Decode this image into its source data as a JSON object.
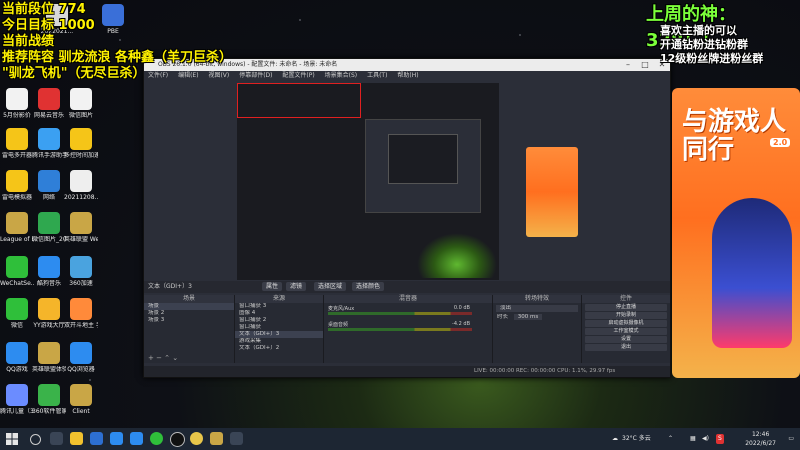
{
  "overlay": {
    "rank": "当前段位 774",
    "goal": "今日目标 1000",
    "record": "当前战绩",
    "lineup": "推荐阵容 驯龙流浪 各种鑫（羊刀巨杀）",
    "lineup2": "\"驯龙飞机\"（无尽巨杀）",
    "god": "上周的神：338！！",
    "notes": [
      "喜欢主播的可以",
      "开通钻粉进钻粉群",
      "12级粉丝牌进粉丝群"
    ]
  },
  "ad": {
    "title": "与游戏人同行",
    "badge": "2.0"
  },
  "desktop_icons": [
    {
      "label": "PBE",
      "color": "#3a6fd8"
    },
    {
      "label": "2022021...",
      "color": "#d8d8d8"
    },
    {
      "label": "5月份影价",
      "color": "#f2f2f2"
    },
    {
      "label": "网易云音乐",
      "color": "#e03232"
    },
    {
      "label": "微信图片",
      "color": "#f2f2f2"
    },
    {
      "label": "雷电多开器",
      "color": "#f5c518"
    },
    {
      "label": "腾讯手游助手",
      "color": "#3ba0f2"
    },
    {
      "label": "多控时间加速",
      "color": "#f5c518"
    },
    {
      "label": "雷电模拟器",
      "color": "#f5c518"
    },
    {
      "label": "网络",
      "color": "#2f7fd8"
    },
    {
      "label": "20211208...",
      "color": "#eeeeee"
    },
    {
      "label": "League of Legends",
      "color": "#c9a646"
    },
    {
      "label": "微信图片_2022021...",
      "color": "#2fa84f"
    },
    {
      "label": "英雄联盟 WeGame版",
      "color": "#c9a646"
    },
    {
      "label": "WeChatSe...",
      "color": "#2fbf3a"
    },
    {
      "label": "酷狗音乐",
      "color": "#2d8cf0"
    },
    {
      "label": "360加速",
      "color": "#4aa3df"
    },
    {
      "label": "微信",
      "color": "#2fbf3a"
    },
    {
      "label": "YY游戏大厅",
      "color": "#f5b52a"
    },
    {
      "label": "双开斗地主 手游联运",
      "color": "#ff8a3a"
    },
    {
      "label": "QQ游戏",
      "color": "#2d8cf0"
    },
    {
      "label": "英雄联盟体验服",
      "color": "#c9a646"
    },
    {
      "label": "QQ浏览器",
      "color": "#2d8cf0"
    },
    {
      "label": "腾讯儿童（3）",
      "color": "#6b8cff"
    },
    {
      "label": "360软件管家",
      "color": "#3ab34a"
    },
    {
      "label": "Client",
      "color": "#c9a646"
    }
  ],
  "obs": {
    "title": "OBS 26.1.0 (64-bit, windows) - 配置文件: 未命名 - 场景: 未命名",
    "menu": [
      "文件(F)",
      "编辑(E)",
      "视图(V)",
      "停靠部件(D)",
      "配置文件(P)",
      "场景集合(S)",
      "工具(T)",
      "帮助(H)"
    ],
    "source_label": "文本（GDI+）3",
    "toolbar": [
      "属性",
      "滤镜",
      "选择区域",
      "选择颜色"
    ],
    "docks": {
      "scenes_title": "场景",
      "scenes": [
        "场景",
        "场景 2",
        "场景 3"
      ],
      "sources_title": "来源",
      "sources": [
        "窗口捕获 3",
        "图像 4",
        "窗口捕获 2",
        "窗口捕获",
        "文本（GDI+）3",
        "游戏采集",
        "文本（GDI+）2"
      ],
      "mixer_title": "混音器",
      "mixer": [
        {
          "label": "麦克风/Aux",
          "db": "0.0 dB"
        },
        {
          "label": "桌面音频",
          "db": "-4.2 dB"
        }
      ],
      "transitions_title": "转场特效",
      "transition_type": "淡出",
      "duration_label": "时长",
      "duration_value": "300 ms",
      "controls_title": "控件",
      "controls": [
        "停止直播",
        "开始录制",
        "启动虚拟摄像机",
        "工作室模式",
        "设置",
        "退出"
      ]
    },
    "status": "LIVE: 00:00:00   REC: 00:00:00   CPU: 1.1%, 29.97 fps"
  },
  "taskbar": {
    "weather": "32°C 多云",
    "time": "12:46",
    "date": "2022/6/27"
  }
}
